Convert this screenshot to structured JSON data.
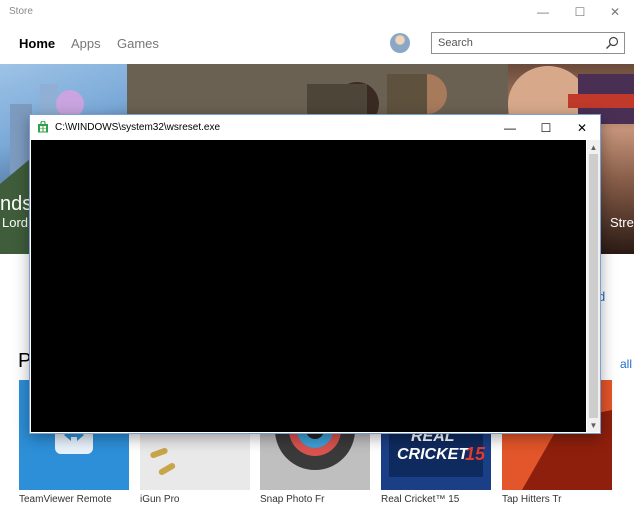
{
  "store": {
    "window_title": "Store",
    "controls": {
      "minimize": "—",
      "maximize": "☐",
      "close": "✕"
    },
    "nav": {
      "home": "Home",
      "apps": "Apps",
      "games": "Games"
    },
    "search": {
      "placeholder": "Search",
      "value": ""
    }
  },
  "hero": {
    "left_text_1": "nds",
    "left_text_2": "Lord",
    "right_text": "Strea"
  },
  "section": {
    "title": "P",
    "link": "all",
    "side_link": "d"
  },
  "tiles": [
    {
      "name": "TeamViewer Remote"
    },
    {
      "name": "iGun Pro"
    },
    {
      "name": "Snap Photo Fr"
    },
    {
      "name": "Real Cricket™ 15"
    },
    {
      "name": "Tap Hitters Tr"
    }
  ],
  "tile_overlay": {
    "real": "REAL",
    "cricket": "CRICKET",
    "number": "15"
  },
  "console": {
    "title": "C:\\WINDOWS\\system32\\wsreset.exe",
    "controls": {
      "minimize": "—",
      "maximize": "☐",
      "close": "✕"
    },
    "scroll_up": "▲",
    "scroll_down": "▼"
  },
  "colors": {
    "accent_link": "#1e6fc4",
    "console_bg": "#000000"
  }
}
